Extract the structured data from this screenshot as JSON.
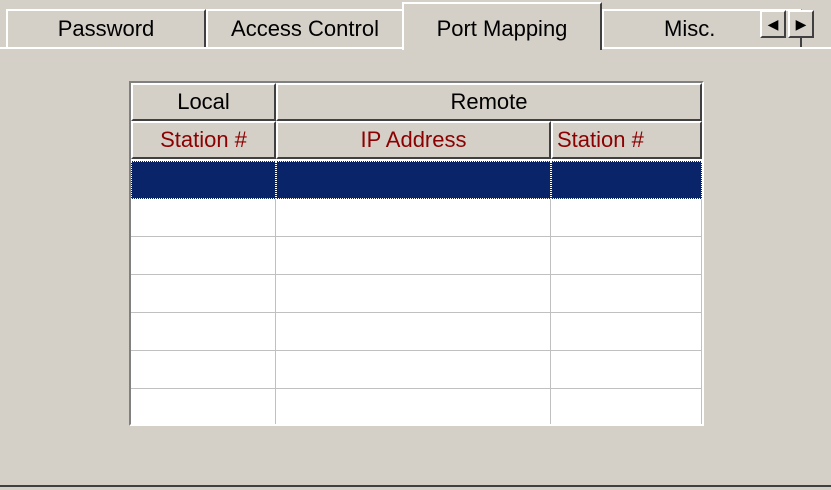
{
  "tabs": [
    {
      "label": "Password",
      "active": false
    },
    {
      "label": "Access Control",
      "active": false
    },
    {
      "label": "Port Mapping",
      "active": true
    },
    {
      "label": "Misc.",
      "active": false
    }
  ],
  "scroll": {
    "left_glyph": "◀",
    "right_glyph": "▶"
  },
  "grid": {
    "group_headers": [
      "Local",
      "Remote"
    ],
    "column_headers": [
      "Station #",
      "IP Address",
      "Station #"
    ],
    "rows": [
      [
        "",
        "",
        ""
      ],
      [
        "",
        "",
        ""
      ],
      [
        "",
        "",
        ""
      ],
      [
        "",
        "",
        ""
      ],
      [
        "",
        "",
        ""
      ],
      [
        "",
        "",
        ""
      ],
      [
        "",
        "",
        ""
      ]
    ],
    "selected_row": 0
  },
  "colors": {
    "face": "#d4d0c8",
    "selection": "#0a246a",
    "header_text_sub": "#8b0000"
  }
}
